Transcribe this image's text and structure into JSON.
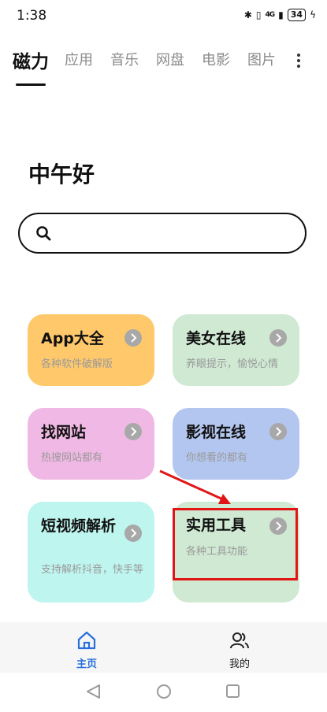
{
  "status": {
    "time": "1:38",
    "signal": "4G",
    "battery": "34"
  },
  "tabs": [
    "磁力",
    "应用",
    "音乐",
    "网盘",
    "电影",
    "图片"
  ],
  "greeting": "中午好",
  "search": {
    "placeholder": ""
  },
  "cards": [
    {
      "title": "App大全",
      "subtitle": "各种软件破解版",
      "color": "#ffc86b"
    },
    {
      "title": "美女在线",
      "subtitle": "养眼提示，愉悦心情",
      "color": "#cfe9d2"
    },
    {
      "title": "找网站",
      "subtitle": "热搜网站都有",
      "color": "#f0b8e4"
    },
    {
      "title": "影视在线",
      "subtitle": "你想看的都有",
      "color": "#b3c6ef"
    },
    {
      "title": "短视频解析",
      "subtitle": "支持解析抖音，快手等",
      "color": "#bff5ef"
    },
    {
      "title": "实用工具",
      "subtitle": "各种工具功能",
      "color": "#cfe9d2"
    }
  ],
  "annotation_color": "#e01616",
  "bottom_nav": {
    "home": "主页",
    "mine": "我的"
  },
  "accent": "#2a6fdb"
}
